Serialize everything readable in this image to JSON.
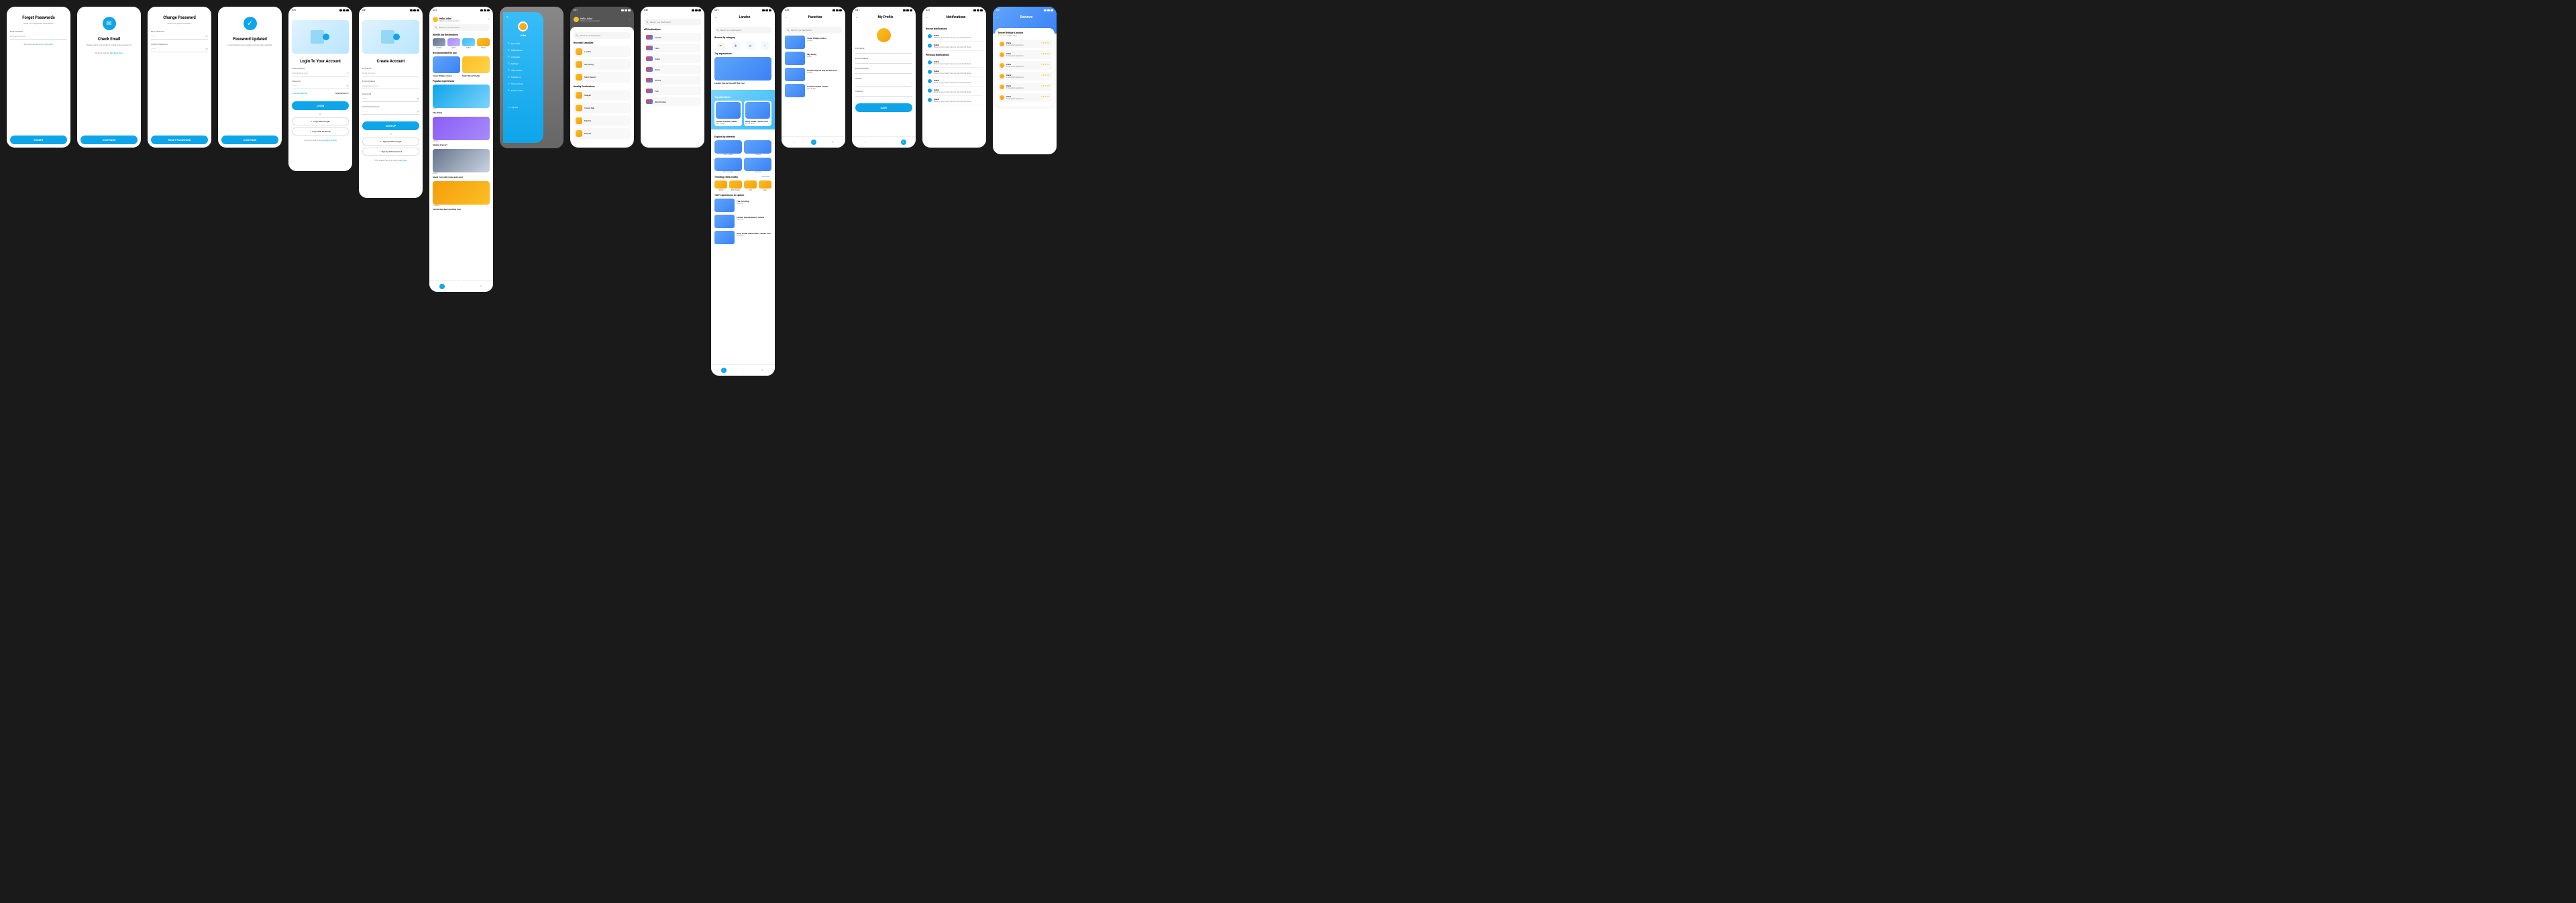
{
  "status_time": "9:41",
  "screens": {
    "forgot": {
      "title": "Forget Passwords",
      "subtitle": "Enter your registered email below",
      "email_label": "Email Address",
      "email_placeholder": "emily@gmail.com",
      "remember_text": "Remember the password?",
      "login_link": "Login Now",
      "submit": "SUBMIT"
    },
    "check_email": {
      "title": "Check Email",
      "subtitle": "Please check your email to create a new password.",
      "not_received": "Email not received?",
      "resend": "Resubmit Now",
      "continue": "CONTINUE"
    },
    "change_pw": {
      "title": "Change Password",
      "subtitle": "Enter new password below",
      "new_pw": "New Password",
      "confirm_pw": "Confirm Password",
      "reset": "RESET PASSWORD"
    },
    "updated": {
      "title": "Password Updated",
      "subtitle": "Congratulations your password has been updated.",
      "continue": "CONTINUE"
    },
    "login": {
      "title": "Login To Your Account",
      "email_label": "Email Address",
      "email_placeholder": "emily@gmail.com",
      "pw_label": "Password",
      "remember": "Remember Me",
      "forgot": "Forget Password ?",
      "login_btn": "LOGIN",
      "or": "Or",
      "google": "Login With Google",
      "facebook": "Login With Facebook",
      "no_account": "If you Don't have an account",
      "signup": "Sign Up Now"
    },
    "create": {
      "title": "Create Account",
      "name_label": "Full Name",
      "name_placeholder": "Emily Johnson",
      "email_label": "Email Address",
      "email_placeholder": "emily@gmail.com",
      "pw_label": "Password",
      "confirm_label": "Confirm Password",
      "signup": "SIGN UP",
      "or": "Or",
      "google": "Sign Up With Google",
      "facebook": "Sign Up With Facebook",
      "have_account": "If you already have an account",
      "login": "Login Now"
    },
    "home": {
      "greeting": "Hello John!",
      "greeting_sub": "Where you wanna go next?",
      "search_placeholder": "Search your destination...",
      "top_dest_title": "World's top destinations",
      "destinations": [
        {
          "name": "London"
        },
        {
          "name": "Paris"
        },
        {
          "name": "Dubai"
        },
        {
          "name": "Rome"
        }
      ],
      "recommended_title": "Recommended for you",
      "rec1": "Tower Bridge London",
      "rec2": "Safari Desert Dubai",
      "popular_title": "Popular experiences",
      "exp1_title": "Sky Diving",
      "exp1_loc": "Dubai",
      "exp2_title": "Singing Concert",
      "exp2_loc": "London",
      "exp3_title": "Island Tour with Cruise and Lunch",
      "exp3_loc": "Miami",
      "exp4_title": "SOI Kitchen Beer and Dine Tour",
      "exp4_loc": "Thailand"
    },
    "drawer": {
      "name": "John",
      "items": [
        "My Profile",
        "Notifications",
        "Language",
        "Settings",
        "Help & FAQ's",
        "Contact us",
        "Terms of Use",
        "Privacy Policy"
      ],
      "logout": "Log Out"
    },
    "recent_search": {
      "greeting": "Hello John!",
      "greeting_sub": "Where you wanna go next?",
      "search_placeholder": "Search your destination...",
      "recent_title": "Recently Searched",
      "recent": [
        "London",
        "Sky Diving",
        "Safari Desert"
      ],
      "nearby_title": "Nearby Destinations",
      "nearby": [
        "Sharjah",
        "Chiang Mai",
        "Madina",
        "Muscat"
      ]
    },
    "all_dest": {
      "search_placeholder": "Search your destination...",
      "title": "All Destinations",
      "items": [
        "London",
        "Paris",
        "Dubai",
        "Rome",
        "Oxford",
        "York",
        "Westminster"
      ]
    },
    "london": {
      "title": "London",
      "search_placeholder": "Search your destination...",
      "browse_title": "Browse by category",
      "top_exp_title": "Top experiences",
      "exp1": "London Hop-On Hop Off Bus Tour",
      "top_attr_title": "Top attractions",
      "attr1": "London Theatre Tickets",
      "attr2": "Harry Potter London Tour",
      "attr1_sub": "from €12.99",
      "attr2_sub": "from €12.99",
      "interests_title": "Explore by interests",
      "int1": "History Geeks",
      "int2": "Couples",
      "int3": "Solo Travelers",
      "int4": "Families",
      "trending_title": "Trending cities nearby",
      "view_more": "View More →",
      "trending": [
        "Oxford",
        "Manchester",
        "York",
        "Dover"
      ],
      "more_title": "150+ experiences to explore",
      "more1": "The Lion King",
      "more1_sub": "from €32",
      "more2": "London Eye Admission Tickets",
      "more2_sub": "from €32",
      "more3": "Harry Potter Warner Bros. Studio Tour",
      "more3_sub": "from €87"
    },
    "favorites": {
      "title": "Favorites",
      "search_placeholder": "Search your destination...",
      "items": [
        {
          "name": "Tower Bridge London",
          "sub": "London"
        },
        {
          "name": "Sky Diving",
          "sub": "Dubai"
        },
        {
          "name": "London Hop-On Hop Off Bus Tour",
          "sub": "London"
        },
        {
          "name": "London Theatre Tickets",
          "sub": "from €12.99"
        }
      ]
    },
    "profile": {
      "title": "My Profile",
      "name_label": "Full Name",
      "email_label": "Email Address",
      "phone_label": "Phone Number",
      "gender_label": "Gender",
      "address_label": "Address",
      "save": "SAVE"
    },
    "notifications": {
      "title": "Notifications",
      "recent_title": "Recent Notifications",
      "prev_title": "Previous Notifications",
      "notif_title": "Dubai",
      "notif_text": "Based on your recent visit you can next visit Dubai",
      "tabs": [
        "Recent",
        "Previous"
      ]
    },
    "reviews": {
      "title": "Reviews",
      "place": "Tower Bridge London",
      "rating": "4.8/5.0 (810)",
      "reviewer": "Chris",
      "review_text": "It was great experience.",
      "time": "5h"
    }
  }
}
